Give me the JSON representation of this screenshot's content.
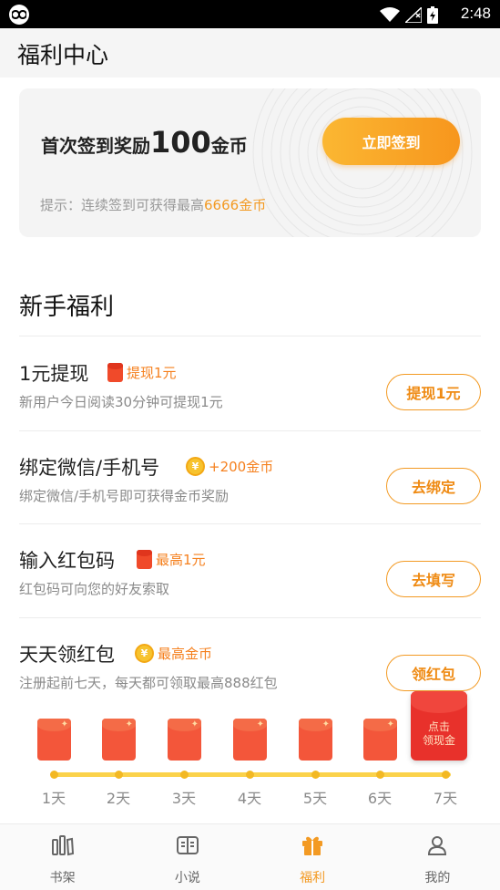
{
  "status_bar": {
    "time": "2:48"
  },
  "app_bar": {
    "title": "福利中心"
  },
  "signin": {
    "title_prefix": "首次签到奖励",
    "amount": "100",
    "unit": "金币",
    "button": "立即签到",
    "tip_prefix": "提示：连续签到可获得最高",
    "tip_highlight": "6666金币"
  },
  "newbie": {
    "title": "新手福利",
    "tasks": [
      {
        "title": "1元提现",
        "badge": "提现1元",
        "badge_icon": "red-packet-icon",
        "desc": "新用户今日阅读30分钟可提现1元",
        "button": "提现1元"
      },
      {
        "title": "绑定微信/手机号",
        "badge": "+200金币",
        "badge_icon": "coin-icon",
        "desc": "绑定微信/手机号即可获得金币奖励",
        "button": "去绑定"
      },
      {
        "title": "输入红包码",
        "badge": "最高1元",
        "badge_icon": "red-packet-icon",
        "desc": "红包码可向您的好友索取",
        "button": "去填写"
      },
      {
        "title": "天天领红包",
        "badge": "最高金币",
        "badge_icon": "coin-icon",
        "desc": "注册起前七天，每天都可领取最高888红包",
        "button": "领红包"
      }
    ]
  },
  "daily_packets": {
    "days": [
      "1天",
      "2天",
      "3天",
      "4天",
      "5天",
      "6天",
      "7天"
    ],
    "cash_packet_line1": "点击",
    "cash_packet_line2": "领现金"
  },
  "bottom_nav": [
    {
      "label": "书架",
      "icon": "bookshelf-icon",
      "active": false
    },
    {
      "label": "小说",
      "icon": "book-icon",
      "active": false
    },
    {
      "label": "福利",
      "icon": "gift-icon",
      "active": true
    },
    {
      "label": "我的",
      "icon": "profile-icon",
      "active": false
    }
  ],
  "colors": {
    "accent": "#f39a23",
    "red": "#f3563a",
    "muted": "#8a8a8a"
  }
}
